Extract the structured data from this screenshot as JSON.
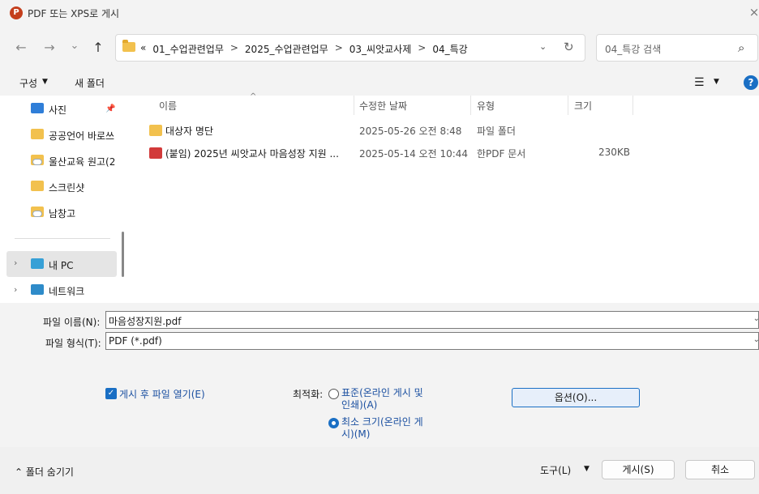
{
  "window": {
    "title": "PDF 또는 XPS로 게시",
    "app_icon": "P",
    "close": "×"
  },
  "nav": {
    "back": "←",
    "forward": "→",
    "recent": "⌄",
    "up": "↑"
  },
  "address": {
    "crumbs": [
      "«",
      "01_수업관련업무",
      ">",
      "2025_수업관련업무",
      ">",
      "03_씨앗교사제",
      ">",
      "04_특강"
    ]
  },
  "search": {
    "placeholder": "04_특강 검색"
  },
  "toolbar": {
    "organize": "구성",
    "new_folder": "새 폴더",
    "help": "?"
  },
  "sidebar": {
    "items": [
      {
        "label": "사진",
        "icon": "pictures-icon"
      },
      {
        "label": "공공언어 바로쓰",
        "icon": "folder-icon"
      },
      {
        "label": "울산교육 원고(2",
        "icon": "cloud-folder-icon"
      },
      {
        "label": "스크린샷",
        "icon": "folder-icon"
      },
      {
        "label": "남창고",
        "icon": "cloud-folder-icon"
      },
      {
        "label": "내 PC",
        "icon": "pc-icon"
      },
      {
        "label": "네트워크",
        "icon": "network-icon"
      }
    ]
  },
  "files": {
    "columns": [
      "이름",
      "수정한 날짜",
      "유형",
      "크기"
    ],
    "rows": [
      {
        "name": "대상자 명단",
        "date": "2025-05-26 오전 8:48",
        "type": "파일 폴더",
        "size": ""
      },
      {
        "name": "(붙임) 2025년 씨앗교사 마음성장 지원 ...",
        "date": "2025-05-14 오전 10:44",
        "type": "한PDF 문서",
        "size": "230KB"
      }
    ]
  },
  "form": {
    "filename_label": "파일 이름(N):",
    "filename_value": "마음성장지원.pdf",
    "filetype_label": "파일 형식(T):",
    "filetype_value": "PDF (*.pdf)",
    "open_after_label": "게시 후 파일 열기(E)",
    "optimize_label": "최적화:",
    "optimize_standard_1": "표준(온라인 게시 및",
    "optimize_standard_2": "인쇄)(A)",
    "optimize_min_1": "최소 크기(온라인 게",
    "optimize_min_2": "시)(M)",
    "options_button": "옵션(O)..."
  },
  "footer": {
    "hide_folders": "폴더 숨기기",
    "tools": "도구(L)",
    "publish": "게시(S)",
    "cancel": "취소"
  },
  "colors": {
    "accent": "#1a6fc4",
    "folder": "#f2c14e",
    "pdf": "#d23a3a"
  }
}
